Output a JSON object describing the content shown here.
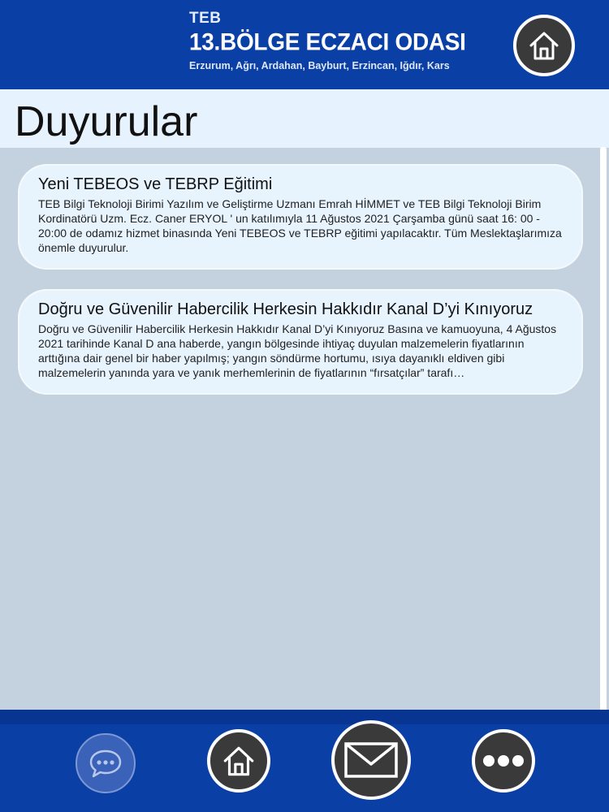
{
  "header": {
    "brand_small": "TEB",
    "org_name": "13.BÖLGE ECZACI ODASI",
    "cities": "Erzurum, Ağrı, Ardahan, Bayburt, Erzincan, Iğdır, Kars",
    "home_icon": "home-icon"
  },
  "page": {
    "title": "Duyurular"
  },
  "announcements": [
    {
      "title": "Yeni TEBEOS ve TEBRP Eğitimi",
      "body": "TEB Bilgi Teknoloji Birimi Yazılım ve Geliştirme Uzmanı Emrah HİMMET ve TEB Bilgi Teknoloji Birim Kordinatörü Uzm. Ecz. Caner ERYOL ' un katılımıyla 11 Ağustos 2021 Çarşamba günü saat 16: 00 - 20:00 de odamız hizmet binasında Yeni TEBEOS ve TEBRP eğitimi yapılacaktır. Tüm Meslektaşlarımıza önemle duyurulur."
    },
    {
      "title": "Doğru ve Güvenilir Habercilik Herkesin Hakkıdır Kanal D’yi Kınıyoruz",
      "body": "Doğru ve Güvenilir Habercilik Herkesin Hakkıdır  Kanal D’yi Kınıyoruz  Basına ve kamuoyuna,  4 Ağustos 2021 tarihinde Kanal D ana haberde, yangın bölgesinde ihtiyaç duyulan malzemelerin fiyatlarının arttığına dair genel bir haber yapılmış; yangın söndürme hortumu, ısıya dayanıklı eldiven gibi malzemelerin yanında yara ve yanık merhemlerinin de fiyatlarının “fırsatçılar” tarafı…"
    }
  ],
  "footer": {
    "buttons": [
      {
        "icon": "chat-icon",
        "active": true
      },
      {
        "icon": "home-icon",
        "active": false
      },
      {
        "icon": "mail-icon",
        "active": false
      },
      {
        "icon": "more-icon",
        "active": false
      }
    ]
  },
  "colors": {
    "header_blue": "#0a3fa6",
    "title_bar": "#e6f2fd",
    "content_bg": "#c3d2de",
    "card_bg": "#e7f3fd",
    "button_dark": "#3a3a3a",
    "button_active": "#3a62b8"
  }
}
